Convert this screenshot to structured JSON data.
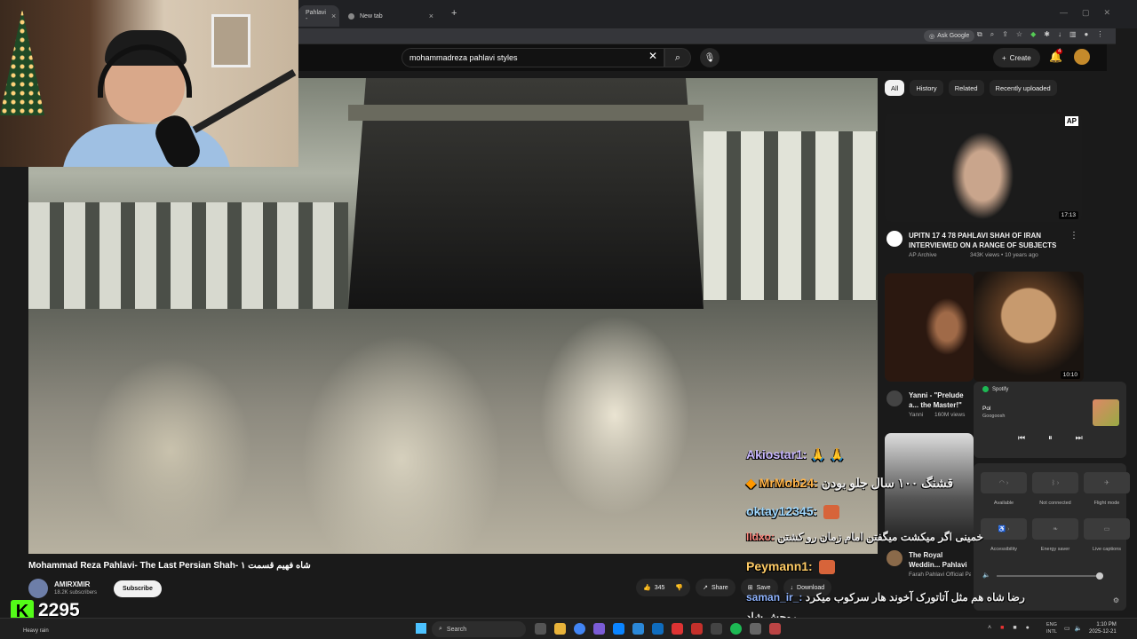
{
  "browser": {
    "tabs": [
      {
        "label": "Pahlavi -",
        "close": "×"
      },
      {
        "label": "New tab",
        "close": "×"
      }
    ],
    "new_tab": "+",
    "ask_google": "Ask Google"
  },
  "youtube": {
    "search_value": "mohammadreza pahlavi styles",
    "create_label": "Create",
    "notification_count": "4"
  },
  "video": {
    "title": "Mohammad Reza Pahlavi- The Last Persian Shah- شاه فهیم قسمت ۱",
    "channel": "AMIRXMIR",
    "subscribers": "18.2K subscribers",
    "subscribe_label": "Subscribe",
    "likes": "345",
    "share_label": "Share",
    "save_label": "Save",
    "download_label": "Download"
  },
  "sidebar": {
    "chips": [
      "All",
      "History",
      "Related",
      "Recently uploaded"
    ],
    "recs": [
      {
        "title": "UPITN 17 4 78 PAHLAVI SHAH OF IRAN INTERVIEWED ON A RANGE OF SUBJECTS",
        "channel": "AP Archive",
        "meta": "343K views • 10 years ago",
        "duration": "17:13",
        "badge": "AP"
      },
      {
        "title": "Yanni - \"Prelude a... the Master!\" \"Yanni",
        "channel": "Yanni",
        "meta": "160M views",
        "duration": "10:10"
      },
      {
        "title": "The Royal Weddin... Pahlavi and Farah",
        "channel": "Farah Pahlavi Official Pa...",
        "meta": ""
      }
    ]
  },
  "spotify": {
    "app": "Spotify",
    "song": "Pol",
    "artist": "Googoosh"
  },
  "quick_settings": {
    "labels": [
      "Available",
      "Not connected",
      "Flight mode",
      "Accessibility",
      "Energy saver",
      "Live captions"
    ]
  },
  "chat": [
    {
      "user": "Akiostar1:",
      "text": "🙏 🙏"
    },
    {
      "user": "MrMob24:",
      "text": "قشنگ ۱۰۰ سال جلو بودن"
    },
    {
      "user": "oktay12345:",
      "text": ""
    },
    {
      "user": "lldxo:",
      "text": "خمینی اگر میکشت میگفتن امام زمان رو کشتن"
    },
    {
      "user": "Peymann1:",
      "text": ""
    },
    {
      "user": "saman_ir_:",
      "text": "رضا شاه هم مثل آتاتورک آخوند هار سرکوب میکرد روحش شاد"
    }
  ],
  "kick": {
    "logo": "K",
    "count": "2295"
  },
  "taskbar": {
    "weather": "Heavy rain",
    "search": "Search",
    "lang1": "ENG",
    "lang2": "INTL",
    "time": "1:10 PM",
    "date": "2025-12-21"
  }
}
